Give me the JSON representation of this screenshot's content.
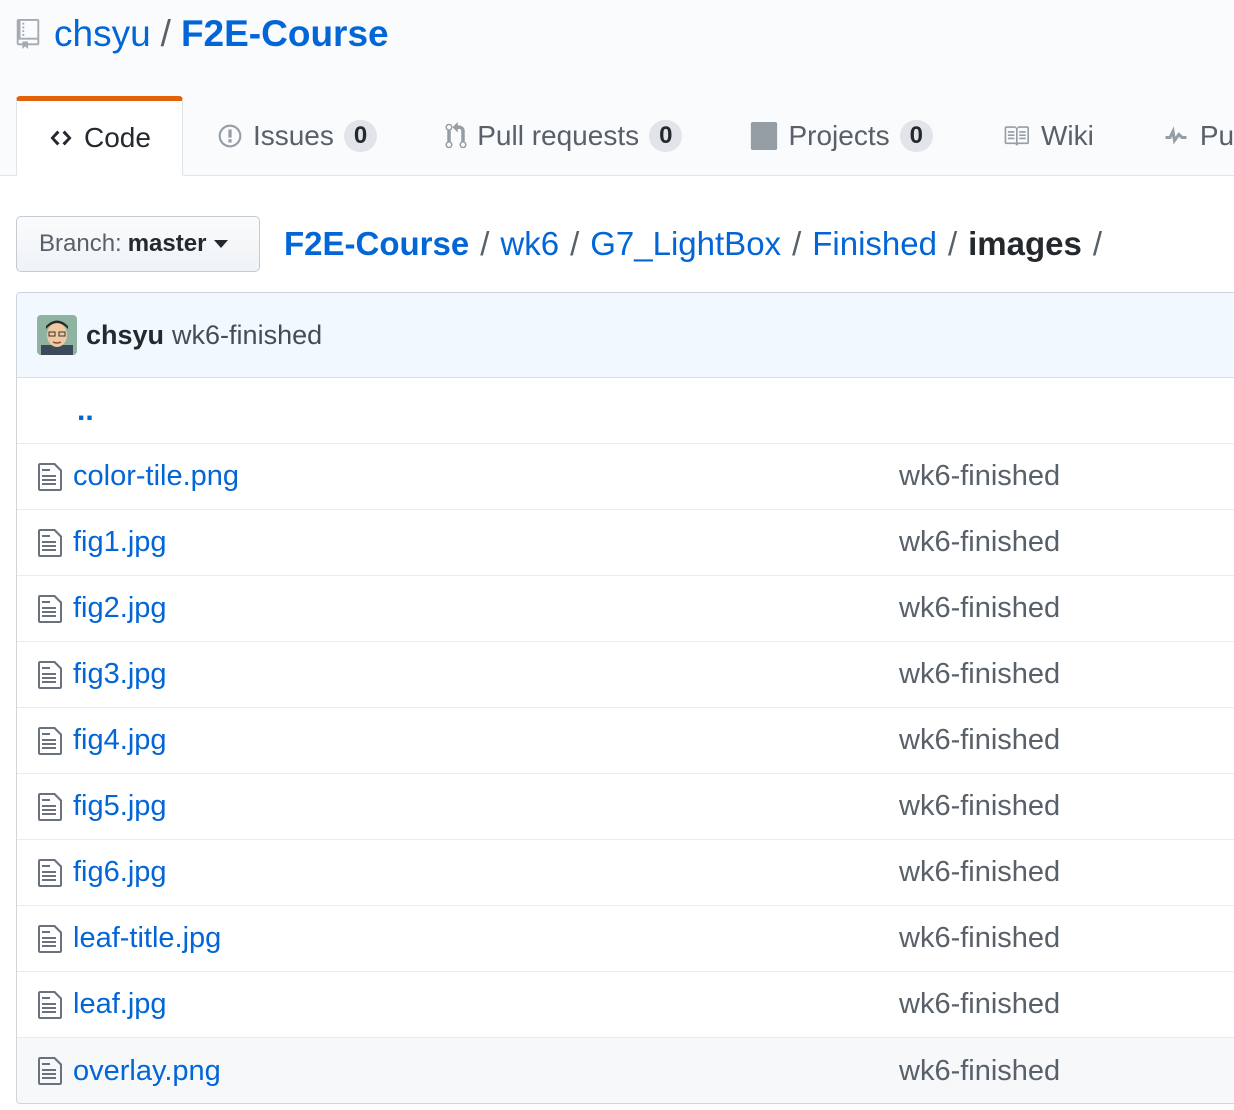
{
  "repo": {
    "owner": "chsyu",
    "separator": "/",
    "name": "F2E-Course"
  },
  "tabs": [
    {
      "label": "Code",
      "icon": "code-icon",
      "selected": true
    },
    {
      "label": "Issues",
      "icon": "issue-opened-icon",
      "count": "0"
    },
    {
      "label": "Pull requests",
      "icon": "git-pull-request-icon",
      "count": "0"
    },
    {
      "label": "Projects",
      "icon": "project-icon",
      "count": "0"
    },
    {
      "label": "Wiki",
      "icon": "book-icon"
    },
    {
      "label": "Pu",
      "icon": "pulse-icon"
    }
  ],
  "branch": {
    "prefix": "Branch:",
    "name": "master"
  },
  "breadcrumb": {
    "separator": "/",
    "links": [
      "F2E-Course",
      "wk6",
      "G7_LightBox",
      "Finished"
    ],
    "current": "images"
  },
  "commit": {
    "author": "chsyu",
    "message": "wk6-finished"
  },
  "up_link": "..",
  "files": [
    {
      "name": "color-tile.png",
      "message": "wk6-finished"
    },
    {
      "name": "fig1.jpg",
      "message": "wk6-finished"
    },
    {
      "name": "fig2.jpg",
      "message": "wk6-finished"
    },
    {
      "name": "fig3.jpg",
      "message": "wk6-finished"
    },
    {
      "name": "fig4.jpg",
      "message": "wk6-finished"
    },
    {
      "name": "fig5.jpg",
      "message": "wk6-finished"
    },
    {
      "name": "fig6.jpg",
      "message": "wk6-finished"
    },
    {
      "name": "leaf-title.jpg",
      "message": "wk6-finished"
    },
    {
      "name": "leaf.jpg",
      "message": "wk6-finished"
    },
    {
      "name": "overlay.png",
      "message": "wk6-finished"
    }
  ],
  "colors": {
    "link": "#0366d6",
    "tab_accent": "#e36209",
    "commit_bg": "#f1f8ff"
  }
}
